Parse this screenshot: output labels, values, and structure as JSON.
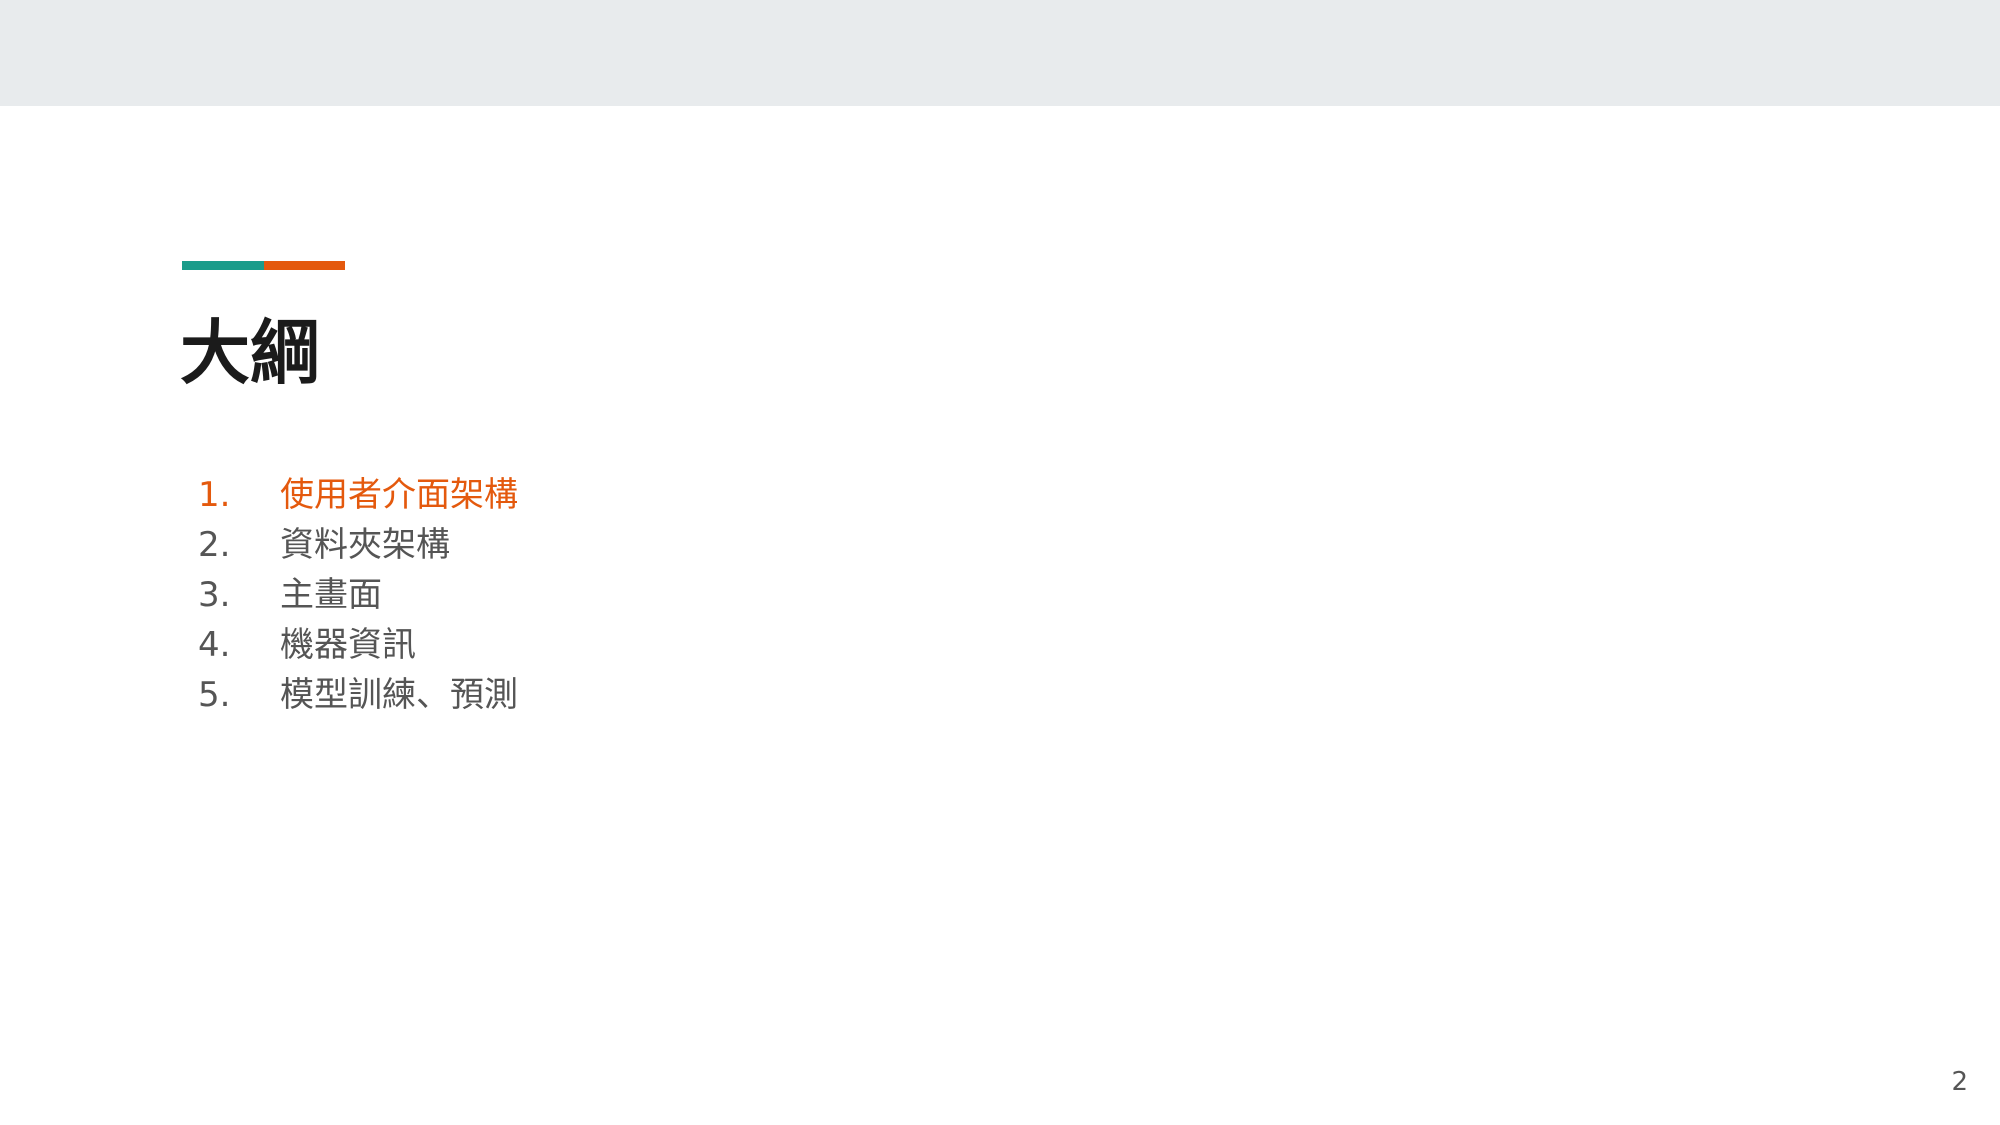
{
  "colors": {
    "header_band": "#e8ebed",
    "accent_teal": "#1a9c8a",
    "accent_orange": "#e4590d",
    "title": "#1b1b1b",
    "active_item": "#e4590d",
    "inactive_item": "#555555"
  },
  "slide": {
    "title": "大綱",
    "outline": [
      {
        "number": "1.",
        "label": "使用者介面架構",
        "active": true
      },
      {
        "number": "2.",
        "label": "資料夾架構",
        "active": false
      },
      {
        "number": "3.",
        "label": "主畫面",
        "active": false
      },
      {
        "number": "4.",
        "label": "機器資訊",
        "active": false
      },
      {
        "number": "5.",
        "label": "模型訓練、預測",
        "active": false
      }
    ],
    "page_number": "2"
  }
}
